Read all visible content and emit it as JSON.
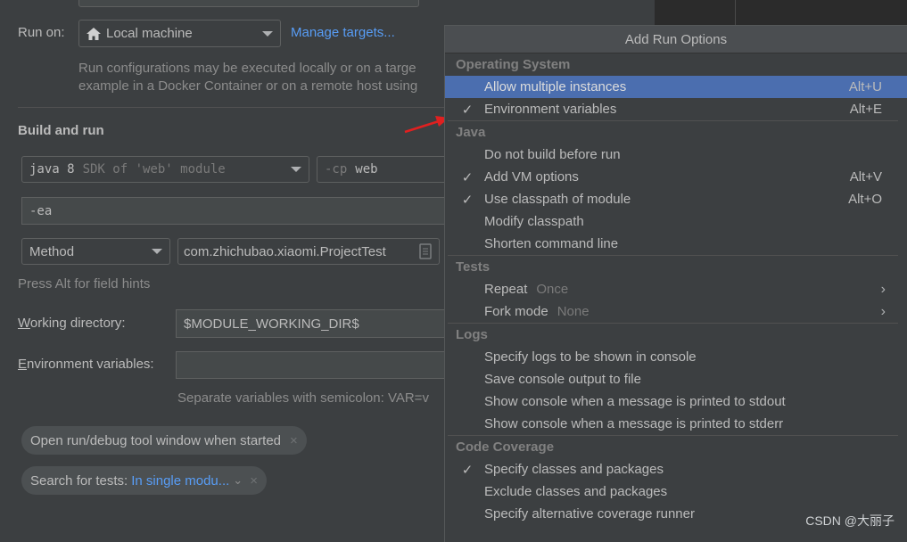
{
  "run_on": {
    "label": "Run on:",
    "target": "Local machine",
    "manage_link": "Manage targets...",
    "description_line1": "Run configurations may be executed locally or on a targe",
    "description_line2": "example in a Docker Container or on a remote host using"
  },
  "build_and_run": {
    "title": "Build and run",
    "jre_main": "java 8",
    "jre_hint": "SDK of 'web' module",
    "cp_prefix": "-cp",
    "cp_value": "web",
    "vm_options": "-ea",
    "test_kind": "Method",
    "test_target": "com.zhichubao.xiaomi.ProjectTest",
    "field_hint": "Press Alt for field hints"
  },
  "working_directory": {
    "label_mnemonic": "W",
    "label_rest": "orking directory:",
    "value": "$MODULE_WORKING_DIR$"
  },
  "environment_variables": {
    "label_mnemonic": "E",
    "label_rest": "nvironment variables:",
    "value": "",
    "hint": "Separate variables with semicolon: VAR=v"
  },
  "chips": {
    "open_tool_window": "Open run/debug tool window when started",
    "search_tests_label": "Search for tests:",
    "search_tests_value": "In single modu..."
  },
  "popup": {
    "title": "Add Run Options",
    "groups": [
      {
        "name": "Operating System",
        "items": [
          {
            "label": "Allow multiple instances",
            "checked": false,
            "shortcut": "Alt+U",
            "selected": true
          },
          {
            "label": "Environment variables",
            "checked": true,
            "shortcut": "Alt+E"
          }
        ]
      },
      {
        "name": "Java",
        "items": [
          {
            "label": "Do not build before run",
            "checked": false
          },
          {
            "label": "Add VM options",
            "checked": true,
            "shortcut": "Alt+V"
          },
          {
            "label": "Use classpath of module",
            "checked": true,
            "shortcut": "Alt+O"
          },
          {
            "label": "Modify classpath",
            "checked": false
          },
          {
            "label": "Shorten command line",
            "checked": false
          }
        ]
      },
      {
        "name": "Tests",
        "items": [
          {
            "label": "Repeat",
            "value": "Once",
            "submenu": true
          },
          {
            "label": "Fork mode",
            "value": "None",
            "submenu": true
          }
        ]
      },
      {
        "name": "Logs",
        "items": [
          {
            "label": "Specify logs to be shown in console",
            "checked": false
          },
          {
            "label": "Save console output to file",
            "checked": false
          },
          {
            "label": "Show console when a message is printed to stdout",
            "checked": false
          },
          {
            "label": "Show console when a message is printed to stderr",
            "checked": false
          }
        ]
      },
      {
        "name": "Code Coverage",
        "items": [
          {
            "label": "Specify classes and packages",
            "checked": true
          },
          {
            "label": "Exclude classes and packages",
            "checked": false
          },
          {
            "label": "Specify alternative coverage runner",
            "checked": false
          }
        ]
      }
    ]
  },
  "icons": {
    "check": "✓",
    "chevron_right": "›",
    "close": "×",
    "chevron_down": "⌄"
  },
  "annotation": {
    "arrow_color": "#e02020"
  },
  "watermark": "CSDN @大丽子"
}
